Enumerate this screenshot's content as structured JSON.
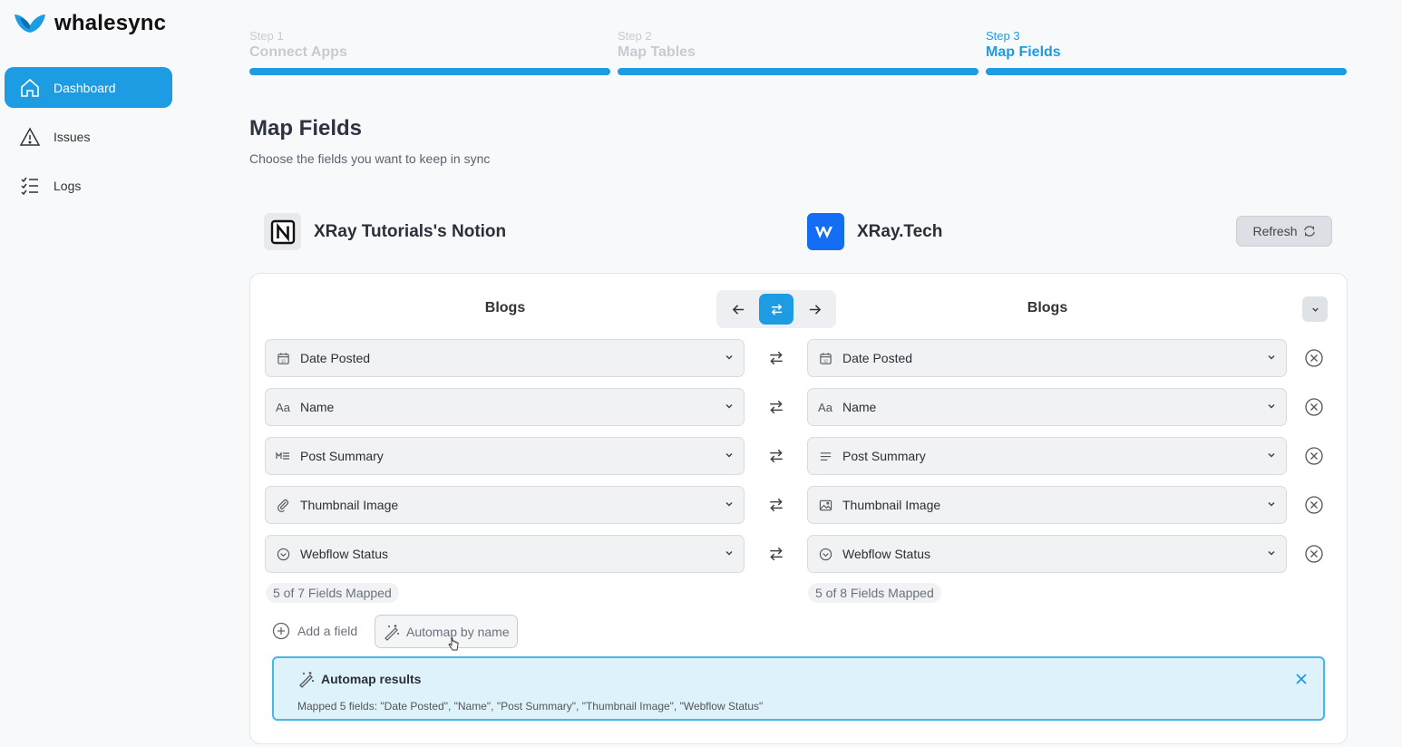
{
  "brand": {
    "name": "whalesync",
    "accent": "#1d9be3"
  },
  "sidebar": {
    "items": [
      {
        "label": "Dashboard",
        "icon": "home-icon",
        "active": true
      },
      {
        "label": "Issues",
        "icon": "warning-icon",
        "active": false
      },
      {
        "label": "Logs",
        "icon": "list-check-icon",
        "active": false
      }
    ]
  },
  "steps": [
    {
      "num": "Step 1",
      "title": "Connect Apps",
      "active": false
    },
    {
      "num": "Step 2",
      "title": "Map Tables",
      "active": false
    },
    {
      "num": "Step 3",
      "title": "Map Fields",
      "active": true
    }
  ],
  "page": {
    "title": "Map Fields",
    "subtitle": "Choose the fields you want to keep in sync"
  },
  "apps": {
    "left": {
      "name": "XRay Tutorials's Notion",
      "icon": "notion-logo-icon"
    },
    "right": {
      "name": "XRay.Tech",
      "icon": "webflow-logo-icon"
    },
    "refresh_label": "Refresh"
  },
  "mapping": {
    "left_table": "Blogs",
    "right_table": "Blogs",
    "rows": [
      {
        "left": "Date Posted",
        "left_icon": "calendar-icon",
        "right": "Date Posted",
        "right_icon": "calendar-icon"
      },
      {
        "left": "Name",
        "left_icon": "text-icon",
        "right": "Name",
        "right_icon": "text-icon"
      },
      {
        "left": "Post Summary",
        "left_icon": "markdown-icon",
        "right": "Post Summary",
        "right_icon": "paragraph-icon"
      },
      {
        "left": "Thumbnail Image",
        "left_icon": "paperclip-icon",
        "right": "Thumbnail Image",
        "right_icon": "image-icon"
      },
      {
        "left": "Webflow Status",
        "left_icon": "status-icon",
        "right": "Webflow Status",
        "right_icon": "status-icon"
      }
    ],
    "left_count": "5 of 7 Fields Mapped",
    "right_count": "5 of 8 Fields Mapped",
    "add_field_label": "Add a field",
    "automap_label": "Automap by name"
  },
  "automap_result": {
    "title": "Automap results",
    "text": "Mapped 5 fields: \"Date Posted\", \"Name\", \"Post Summary\", \"Thumbnail Image\", \"Webflow Status\""
  }
}
